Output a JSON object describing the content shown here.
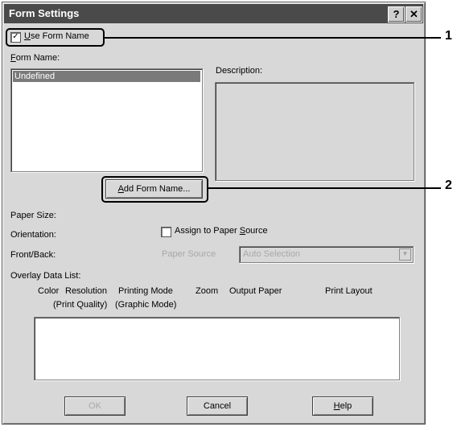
{
  "window": {
    "title": "Form Settings",
    "help_btn": "?",
    "close_btn": "✕"
  },
  "use_form_name": {
    "checked": true,
    "check_mark": "✓",
    "label_u": "U",
    "label_rest": "se Form Name"
  },
  "form_name": {
    "label_u": "F",
    "label_rest": "orm Name:",
    "items": [
      "Undefined"
    ]
  },
  "description": {
    "label": "Description:"
  },
  "add_form_name": {
    "label_u": "A",
    "label_rest": "dd Form Name..."
  },
  "paper_size": {
    "label": "Paper Size:"
  },
  "orientation": {
    "label": "Orientation:"
  },
  "assign_source": {
    "checked": false,
    "label_pre": "Assign to Paper ",
    "label_u": "S",
    "label_rest": "ource"
  },
  "front_back": {
    "label": "Front/Back:"
  },
  "paper_source": {
    "label": "Paper Source",
    "value": "Auto Selection"
  },
  "overlay": {
    "label": "Overlay Data List:",
    "columns": {
      "color": "Color",
      "resolution": "Resolution",
      "print_quality": "(Print Quality)",
      "printing_mode": "Printing Mode",
      "graphic_mode": "(Graphic Mode)",
      "zoom": "Zoom",
      "output_paper": "Output Paper",
      "print_layout": "Print Layout"
    }
  },
  "footer": {
    "ok": "OK",
    "cancel": "Cancel",
    "help_u": "H",
    "help_rest": "elp"
  },
  "callouts": [
    "1",
    "2"
  ]
}
